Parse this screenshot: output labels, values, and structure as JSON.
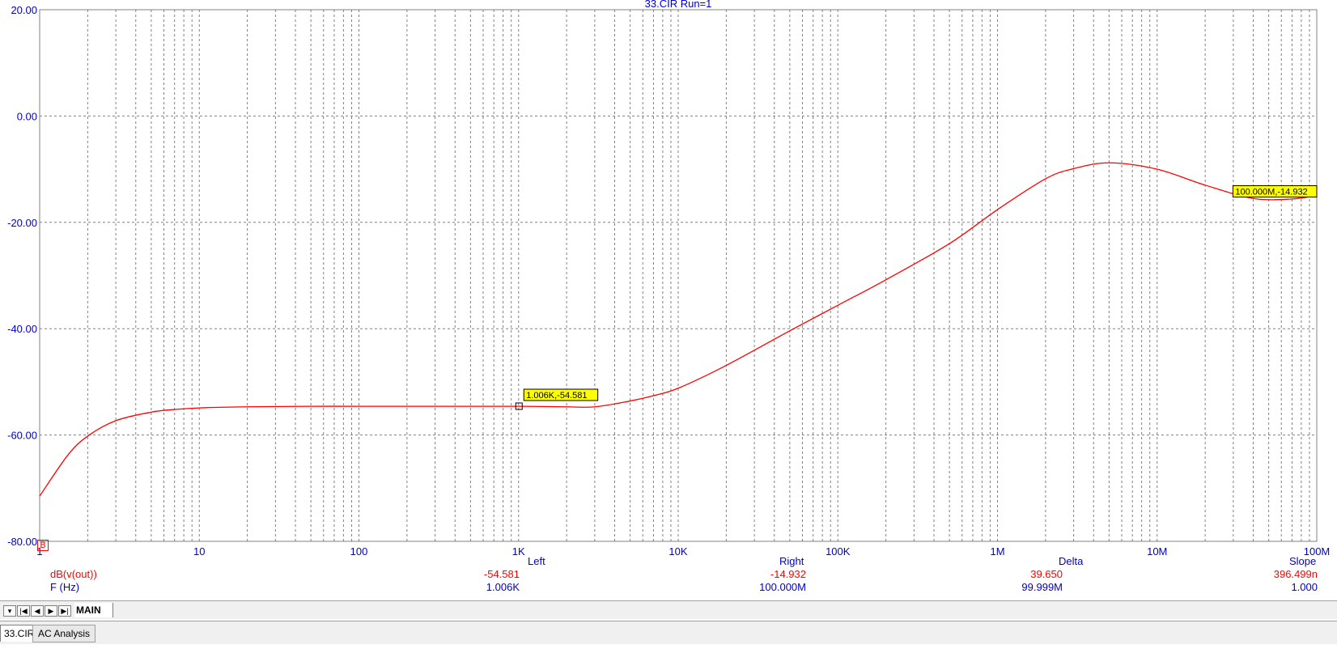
{
  "chart_data": {
    "type": "line",
    "title": "33.CIR Run=1",
    "x_scale": "log",
    "xlim": [
      1,
      100000000
    ],
    "ylim": [
      -80,
      20
    ],
    "grid": true,
    "x_ticks": [
      {
        "value": 1,
        "label": "1"
      },
      {
        "value": 10,
        "label": "10"
      },
      {
        "value": 100,
        "label": "100"
      },
      {
        "value": 1000,
        "label": "1K"
      },
      {
        "value": 10000,
        "label": "10K"
      },
      {
        "value": 100000,
        "label": "100K"
      },
      {
        "value": 1000000,
        "label": "1M"
      },
      {
        "value": 10000000,
        "label": "10M"
      },
      {
        "value": 100000000,
        "label": "100M"
      }
    ],
    "y_ticks": [
      {
        "value": 20,
        "label": "20.00"
      },
      {
        "value": 0,
        "label": "0.00"
      },
      {
        "value": -20,
        "label": "-20.00"
      },
      {
        "value": -40,
        "label": "-40.00"
      },
      {
        "value": -60,
        "label": "-60.00"
      },
      {
        "value": -80,
        "label": "-80.00"
      }
    ],
    "series": [
      {
        "name": "dB(v(out))",
        "color": "#ff0000",
        "x": [
          1,
          1.5,
          2,
          3,
          5,
          7,
          10,
          20,
          50,
          100,
          300,
          1000,
          2000,
          3000,
          5000,
          7000,
          10000,
          20000,
          50000,
          100000,
          200000,
          500000,
          1000000,
          2000000,
          3000000,
          5000000,
          10000000,
          20000000,
          40000000,
          70000000,
          100000000
        ],
        "y": [
          -71.5,
          -63.8,
          -60.2,
          -57.3,
          -55.7,
          -55.2,
          -54.9,
          -54.7,
          -54.6,
          -54.6,
          -54.6,
          -54.6,
          -54.7,
          -54.7,
          -53.6,
          -52.6,
          -51.2,
          -46.9,
          -40.4,
          -35.6,
          -30.8,
          -24.0,
          -17.6,
          -11.8,
          -9.9,
          -8.8,
          -10.0,
          -13.0,
          -15.5,
          -15.6,
          -14.9
        ]
      }
    ],
    "cursors": [
      {
        "x": 1006,
        "y": -54.581,
        "label": "1.006K,-54.581",
        "marker": true
      },
      {
        "x": 100000000,
        "y": -14.932,
        "label": "100.000M,-14.932",
        "marker": false
      }
    ]
  },
  "readout": {
    "headers": {
      "left": "Left",
      "right": "Right",
      "delta": "Delta",
      "slope": "Slope"
    },
    "rows": [
      {
        "marker": "B",
        "name": "dB(v(out))",
        "left": "-54.581",
        "right": "-14.932",
        "delta": "39.650",
        "slope": "396.499n"
      },
      {
        "name": "F (Hz)",
        "left": "1.006K",
        "right": "100.000M",
        "delta": "99.999M",
        "slope": "1.000"
      }
    ]
  },
  "sheet_tabs": {
    "nav": [
      "▾",
      "|◀",
      "◀",
      "▶",
      "▶|"
    ],
    "active": "MAIN"
  },
  "file_tabs": [
    "33.CIR",
    "AC Analysis"
  ],
  "colors": {
    "axis_text": "#0000cc",
    "trace": "#ff0000",
    "cursor_label_bg": "#ffff00",
    "grid": "#808080"
  }
}
